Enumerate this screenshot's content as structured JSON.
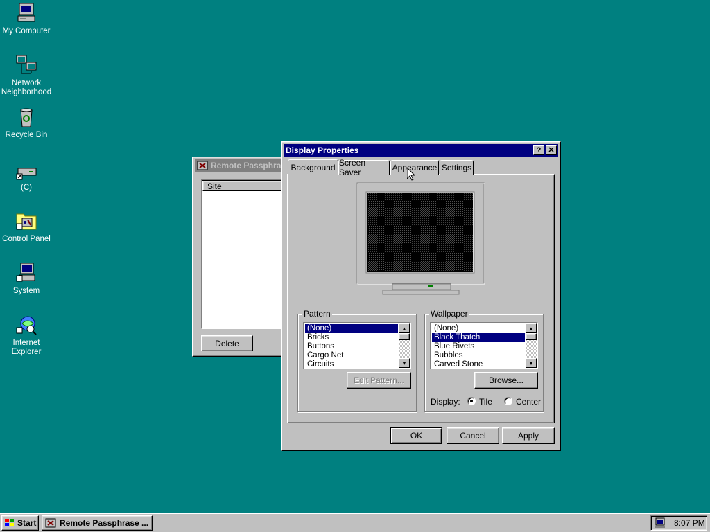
{
  "desktop": {
    "background_color": "#008080",
    "icons": [
      {
        "label": "My Computer",
        "icon": "computer-icon"
      },
      {
        "label": "Network\nNeighborhood",
        "icon": "network-icon"
      },
      {
        "label": "Recycle Bin",
        "icon": "recycle-bin-icon"
      },
      {
        "label": "(C)",
        "icon": "drive-shortcut-icon"
      },
      {
        "label": "Control Panel",
        "icon": "control-panel-icon"
      },
      {
        "label": "System",
        "icon": "system-icon"
      },
      {
        "label": "Internet\nExplorer",
        "icon": "internet-explorer-icon"
      }
    ]
  },
  "remote_window": {
    "title": "Remote Passphrase",
    "column_header": "Site",
    "delete_label": "Delete"
  },
  "display_properties": {
    "title": "Display Properties",
    "help_label": "?",
    "close_label": "✕",
    "tabs": [
      "Background",
      "Screen Saver",
      "Appearance",
      "Settings"
    ],
    "active_tab": "Background",
    "pattern": {
      "label": "Pattern",
      "items": [
        "(None)",
        "Bricks",
        "Buttons",
        "Cargo Net",
        "Circuits"
      ],
      "selected": "(None)",
      "edit_label": "Edit Pattern..."
    },
    "wallpaper": {
      "label": "Wallpaper",
      "items": [
        "(None)",
        "Black Thatch",
        "Blue Rivets",
        "Bubbles",
        "Carved Stone"
      ],
      "selected": "Black Thatch",
      "browse_label": "Browse...",
      "display_label": "Display:",
      "options": [
        "Tile",
        "Center"
      ],
      "selected_option": "Tile"
    },
    "buttons": {
      "ok": "OK",
      "cancel": "Cancel",
      "apply": "Apply"
    }
  },
  "taskbar": {
    "start_label": "Start",
    "task_label": "Remote Passphrase ...",
    "clock": "8:07 PM"
  }
}
